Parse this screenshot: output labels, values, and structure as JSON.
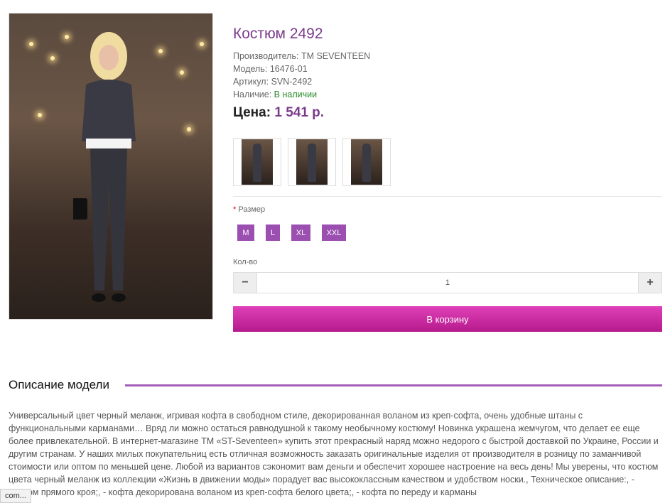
{
  "product": {
    "title": "Костюм 2492",
    "manufacturer_label": "Производитель:",
    "manufacturer": "TM SEVENTEEN",
    "model_label": "Модель:",
    "model": "16476-01",
    "sku_label": "Артикул:",
    "sku": "SVN-2492",
    "availability_label": "Наличие:",
    "availability": "В наличии",
    "price_label": "Цена:",
    "price": "1 541 р."
  },
  "options": {
    "size_label": "Размер",
    "required_mark": "*",
    "sizes": [
      "M",
      "L",
      "XL",
      "XXL"
    ]
  },
  "quantity": {
    "label": "Кол-во",
    "minus": "−",
    "plus": "+",
    "value": "1"
  },
  "cart_button": "В корзину",
  "description": {
    "title": "Описание модели",
    "text": "Универсальный цвет черный меланж, игривая кофта в свободном стиле, декорированная воланом из креп-софта, очень удобные штаны с функциональными карманами… Вряд ли можно остаться равнодушной к такому необычному костюму! Новинка украшена жемчугом, что делает ее еще более привлекательной. В интернет-магазине ТМ «ST-Seventeen» купить этот прекрасный наряд можно недорого с быстрой доставкой по Украине, России и другим странам. У наших милых покупательниц есть отличная возможность заказать оригинальные изделия от производителя в розницу по заманчивой стоимости или оптом по меньшей цене. Любой из вариантов сэкономит вам деньги и обеспечит хорошее настроение на весь день! Мы уверены, что костюм цвета черный меланж из коллекции «Жизнь в движении моды» порадует вас высококлассным качеством и удобством носки., Техническое описание:, - костюм прямого кроя;, - кофта декорирована воланом из креп-софта белого цвета;, - кофта по переду и карманы"
  },
  "status_bar": "com..."
}
